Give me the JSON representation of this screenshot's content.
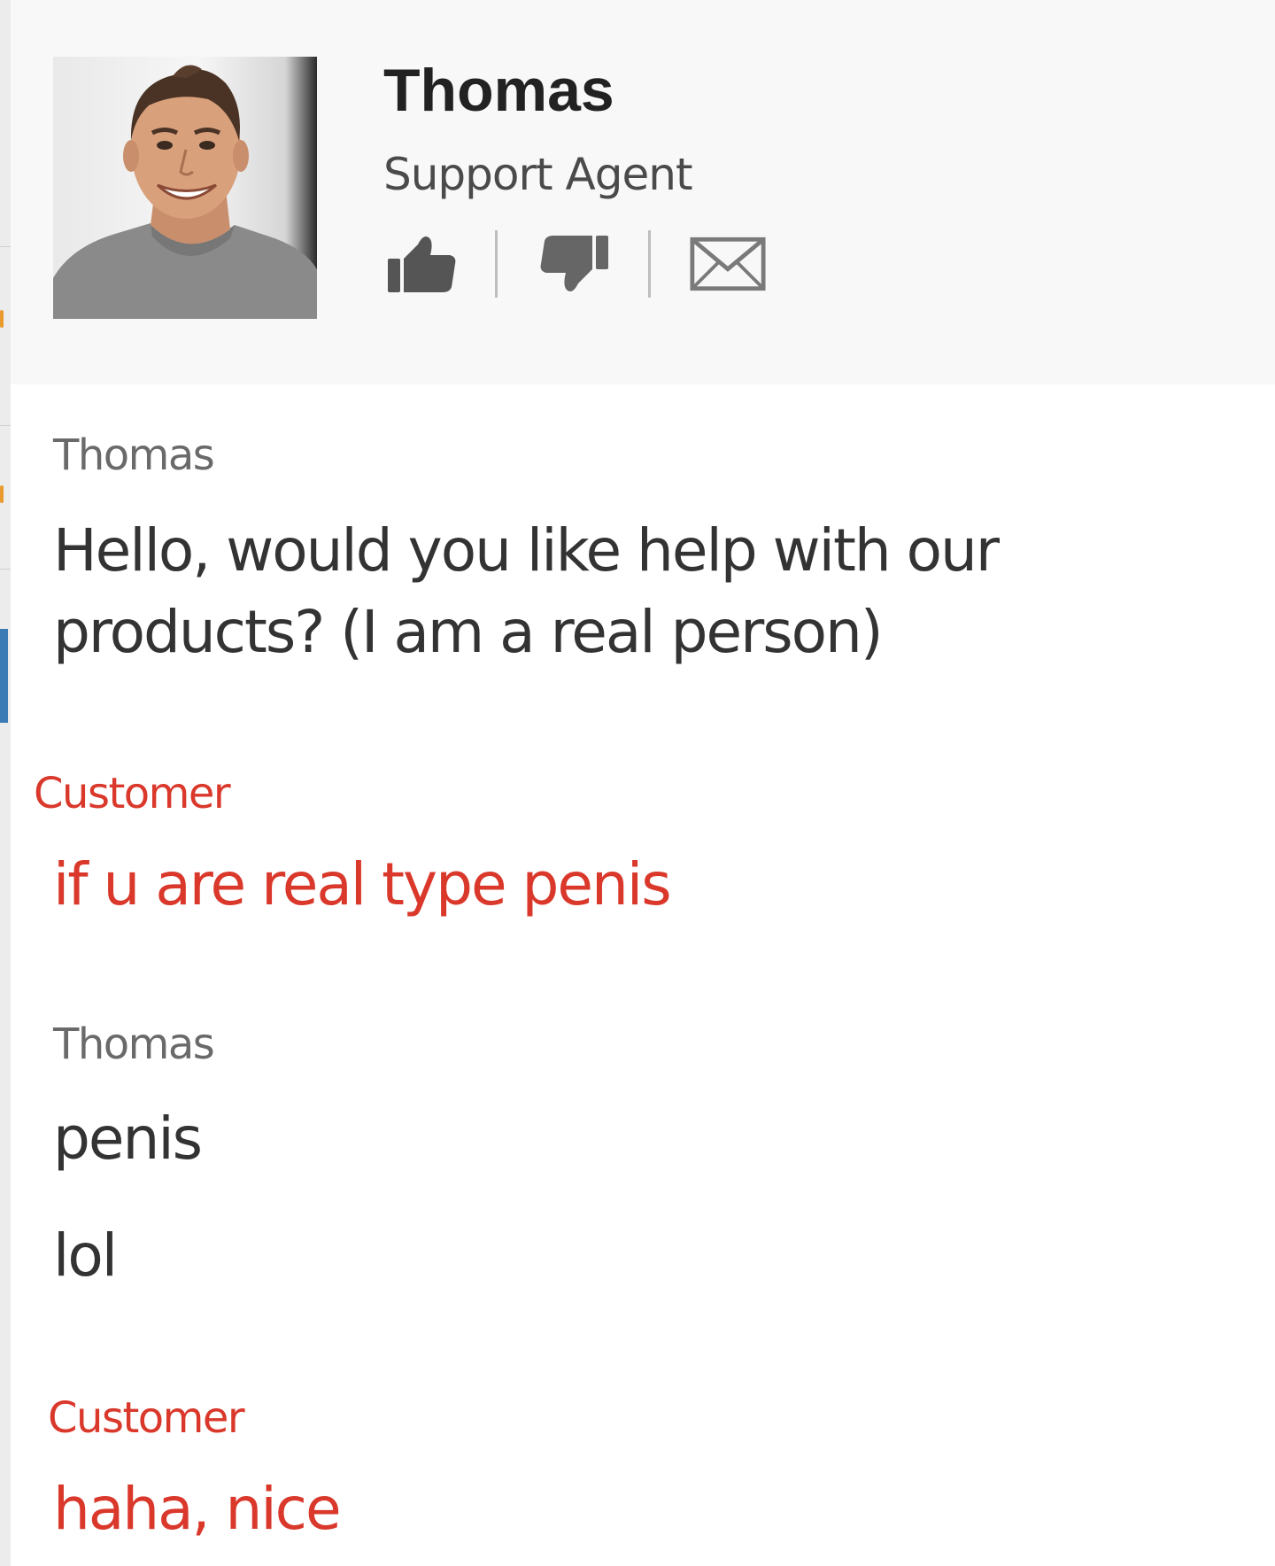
{
  "agent": {
    "name": "Thomas",
    "role": "Support Agent",
    "actions": {
      "like_icon": "thumbs-up-icon",
      "dislike_icon": "thumbs-down-icon",
      "email_icon": "envelope-icon"
    }
  },
  "colors": {
    "agent_text": "#333333",
    "customer_text": "#d9382b",
    "header_bg": "#f8f8f8"
  },
  "messages": [
    {
      "author": "Thomas",
      "text": "Hello, would you like help with our products? (I am a real person)"
    },
    {
      "author": "Customer",
      "text": "if u are real type penis"
    },
    {
      "author": "Thomas",
      "text": "penis"
    },
    {
      "text": "lol"
    },
    {
      "author": "Customer",
      "text": "haha, nice"
    }
  ]
}
